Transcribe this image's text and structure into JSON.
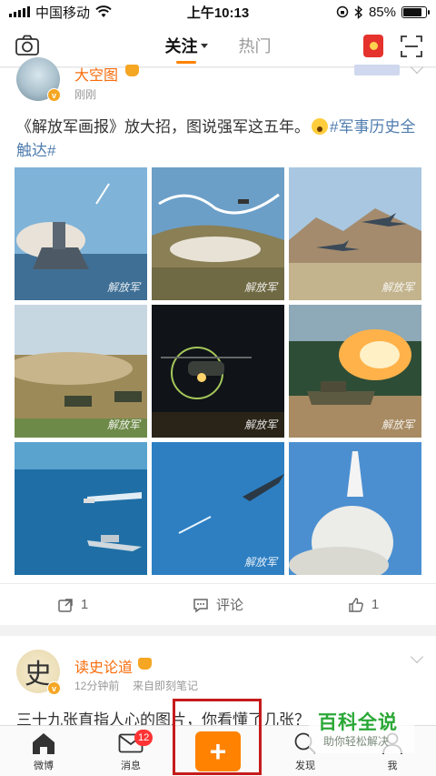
{
  "status_bar": {
    "carrier": "中国移动",
    "time": "上午10:13",
    "battery": "85%",
    "battery_level": 0.85
  },
  "top_nav": {
    "tabs": [
      {
        "label": "关注",
        "active": true
      },
      {
        "label": "热门",
        "active": false
      }
    ],
    "icons": [
      "camera-icon",
      "red-packet-icon",
      "scan-icon"
    ]
  },
  "posts": [
    {
      "user": "大空图",
      "time": "刚刚",
      "text": "《解放军画报》放大招，图说强军这五年。",
      "hashtag": "#军事历史全触达#",
      "photo_watermark": "解放军",
      "actions": {
        "repost": "1",
        "comment": "评论",
        "like": "1"
      }
    },
    {
      "user": "读史论道",
      "avatar_char": "史",
      "time": "12分钟前",
      "source": "来自即刻笔记",
      "text": "三十九张直指人心的图片，你看懂了几张？"
    }
  ],
  "tab_bar": {
    "items": [
      {
        "label": "微博",
        "icon": "home-icon"
      },
      {
        "label": "消息",
        "icon": "message-icon",
        "badge": "12"
      },
      {
        "label": "",
        "icon": "plus-icon"
      },
      {
        "label": "发现",
        "icon": "discover-icon"
      },
      {
        "label": "我",
        "icon": "profile-icon"
      }
    ],
    "compose_symbol": "+"
  },
  "overlay_watermark": {
    "title": "百科全说",
    "subtitle": "助你轻松解决"
  },
  "colors": {
    "accent": "#ff8200",
    "username": "#f86d0d",
    "hashtag": "#507daf",
    "highlight_box": "#c61b1b",
    "badge": "#ff3333"
  }
}
